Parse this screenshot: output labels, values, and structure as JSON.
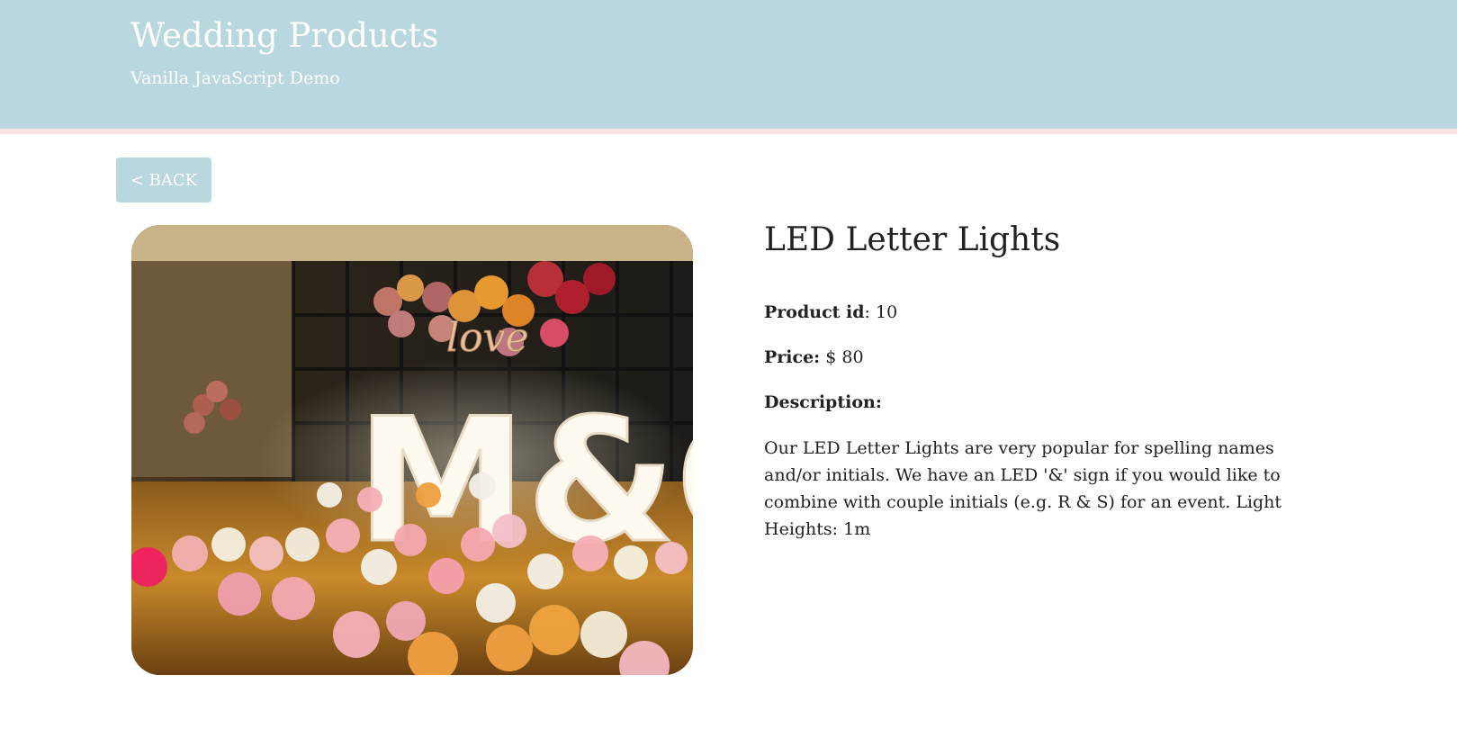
{
  "header": {
    "title": "Wedding Products",
    "subtitle": "Vanilla JavaScript Demo"
  },
  "back_button": {
    "label": "< BACK"
  },
  "product": {
    "title": "LED Letter Lights",
    "id_label": "Product id",
    "id_value": ": 10",
    "price_label": "Price:",
    "price_value": " $ 80",
    "description_label": "Description:",
    "description": "Our LED Letter Lights are very popular for spelling names and/or initials. We have an LED '&' sign if you would like to combine with couple initials (e.g. R & S) for an event. Light Heights: 1m",
    "image": {
      "depicts": "photo",
      "letters": "M&C",
      "balloon_text": "love"
    }
  },
  "colors": {
    "header_bg": "#b8d7df",
    "header_border": "#fbe3e8",
    "button_bg": "#b8d7df",
    "text": "#222222"
  }
}
